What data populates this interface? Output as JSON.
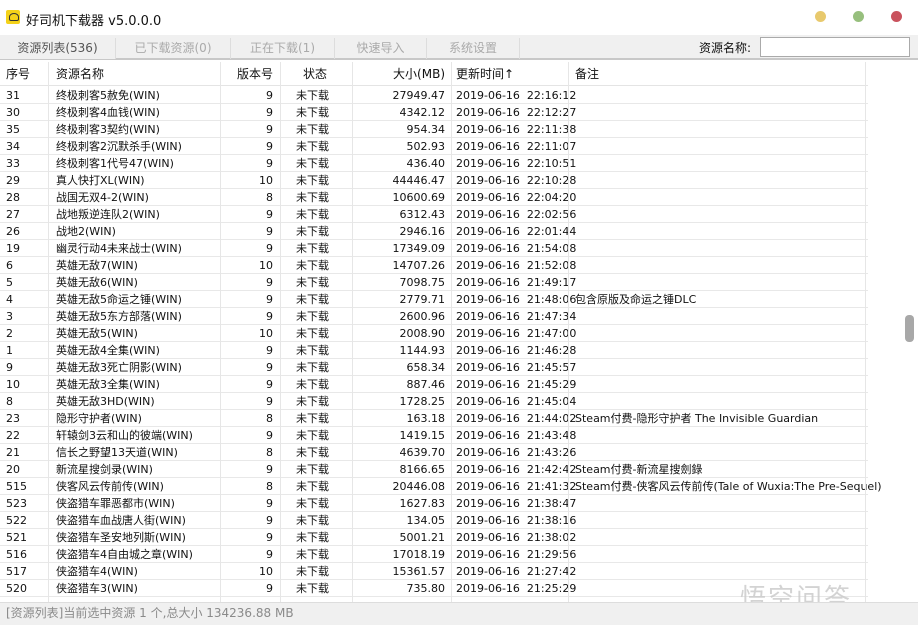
{
  "window": {
    "title": "好司机下载器 v5.0.0.0",
    "controls": {
      "minimize": "#e8c96d",
      "maximize": "#97bf7d",
      "close": "#c9525d"
    }
  },
  "tabs": [
    {
      "label": "资源列表(536)"
    },
    {
      "label": "已下载资源(0)"
    },
    {
      "label": "正在下载(1)"
    },
    {
      "label": "快速导入"
    },
    {
      "label": "系统设置"
    }
  ],
  "search": {
    "label": "资源名称:",
    "value": ""
  },
  "columns": {
    "id": "序号",
    "name": "资源名称",
    "version": "版本号",
    "status": "状态",
    "size": "大小(MB)",
    "time": "更新时间↑",
    "remark": "备注"
  },
  "rows": [
    [
      "31",
      "终极刺客5赦免(WIN)",
      "9",
      "未下载",
      "27949.47",
      "2019-06-16  22:16:12",
      ""
    ],
    [
      "30",
      "终极刺客4血钱(WIN)",
      "9",
      "未下载",
      "4342.12",
      "2019-06-16  22:12:27",
      ""
    ],
    [
      "35",
      "终极刺客3契约(WIN)",
      "9",
      "未下载",
      "954.34",
      "2019-06-16  22:11:38",
      ""
    ],
    [
      "34",
      "终极刺客2沉默杀手(WIN)",
      "9",
      "未下载",
      "502.93",
      "2019-06-16  22:11:07",
      ""
    ],
    [
      "33",
      "终极刺客1代号47(WIN)",
      "9",
      "未下载",
      "436.40",
      "2019-06-16  22:10:51",
      ""
    ],
    [
      "29",
      "真人快打XL(WIN)",
      "10",
      "未下载",
      "44446.47",
      "2019-06-16  22:10:28",
      ""
    ],
    [
      "28",
      "战国无双4-2(WIN)",
      "8",
      "未下载",
      "10600.69",
      "2019-06-16  22:04:20",
      ""
    ],
    [
      "27",
      "战地叛逆连队2(WIN)",
      "9",
      "未下载",
      "6312.43",
      "2019-06-16  22:02:56",
      ""
    ],
    [
      "26",
      "战地2(WIN)",
      "9",
      "未下载",
      "2946.16",
      "2019-06-16  22:01:44",
      ""
    ],
    [
      "19",
      "幽灵行动4未来战士(WIN)",
      "9",
      "未下载",
      "17349.09",
      "2019-06-16  21:54:08",
      ""
    ],
    [
      "6",
      "英雄无敌7(WIN)",
      "10",
      "未下载",
      "14707.26",
      "2019-06-16  21:52:08",
      ""
    ],
    [
      "5",
      "英雄无敌6(WIN)",
      "9",
      "未下载",
      "7098.75",
      "2019-06-16  21:49:17",
      ""
    ],
    [
      "4",
      "英雄无敌5命运之锤(WIN)",
      "9",
      "未下载",
      "2779.71",
      "2019-06-16  21:48:06",
      "包含原版及命运之锤DLC"
    ],
    [
      "3",
      "英雄无敌5东方部落(WIN)",
      "9",
      "未下载",
      "2600.96",
      "2019-06-16  21:47:34",
      ""
    ],
    [
      "2",
      "英雄无敌5(WIN)",
      "10",
      "未下载",
      "2008.90",
      "2019-06-16  21:47:00",
      ""
    ],
    [
      "1",
      "英雄无敌4全集(WIN)",
      "9",
      "未下载",
      "1144.93",
      "2019-06-16  21:46:28",
      ""
    ],
    [
      "9",
      "英雄无敌3死亡阴影(WIN)",
      "9",
      "未下载",
      "658.34",
      "2019-06-16  21:45:57",
      ""
    ],
    [
      "10",
      "英雄无敌3全集(WIN)",
      "9",
      "未下载",
      "887.46",
      "2019-06-16  21:45:29",
      ""
    ],
    [
      "8",
      "英雄无敌3HD(WIN)",
      "9",
      "未下载",
      "1728.25",
      "2019-06-16  21:45:04",
      ""
    ],
    [
      "23",
      "隐形守护者(WIN)",
      "8",
      "未下载",
      "163.18",
      "2019-06-16  21:44:02",
      "Steam付费-隐形守护者 The Invisible Guardian"
    ],
    [
      "22",
      "轩辕剑3云和山的彼端(WIN)",
      "9",
      "未下载",
      "1419.15",
      "2019-06-16  21:43:48",
      ""
    ],
    [
      "21",
      "信长之野望13天道(WIN)",
      "8",
      "未下载",
      "4639.70",
      "2019-06-16  21:43:26",
      ""
    ],
    [
      "20",
      "新流星搜剑录(WIN)",
      "9",
      "未下载",
      "8166.65",
      "2019-06-16  21:42:42",
      "Steam付费-新流星搜劍錄"
    ],
    [
      "515",
      "侠客风云传前传(WIN)",
      "8",
      "未下载",
      "20446.08",
      "2019-06-16  21:41:32",
      "Steam付费-侠客风云传前传(Tale of Wuxia:The Pre-Sequel)"
    ],
    [
      "523",
      "侠盗猎车罪恶都市(WIN)",
      "9",
      "未下载",
      "1627.83",
      "2019-06-16  21:38:47",
      ""
    ],
    [
      "522",
      "侠盗猎车血战唐人街(WIN)",
      "9",
      "未下载",
      "134.05",
      "2019-06-16  21:38:16",
      ""
    ],
    [
      "521",
      "侠盗猎车圣安地列斯(WIN)",
      "9",
      "未下载",
      "5001.21",
      "2019-06-16  21:38:02",
      ""
    ],
    [
      "516",
      "侠盗猎车4自由城之章(WIN)",
      "9",
      "未下载",
      "17018.19",
      "2019-06-16  21:29:56",
      ""
    ],
    [
      "517",
      "侠盗猎车4(WIN)",
      "10",
      "未下载",
      "15361.57",
      "2019-06-16  21:27:42",
      ""
    ],
    [
      "520",
      "侠盗猎车3(WIN)",
      "9",
      "未下载",
      "735.80",
      "2019-06-16  21:25:29",
      ""
    ]
  ],
  "statusbar": "[资源列表]当前选中资源 1 个,总大小 134236.88 MB",
  "watermark": "悟空问答"
}
